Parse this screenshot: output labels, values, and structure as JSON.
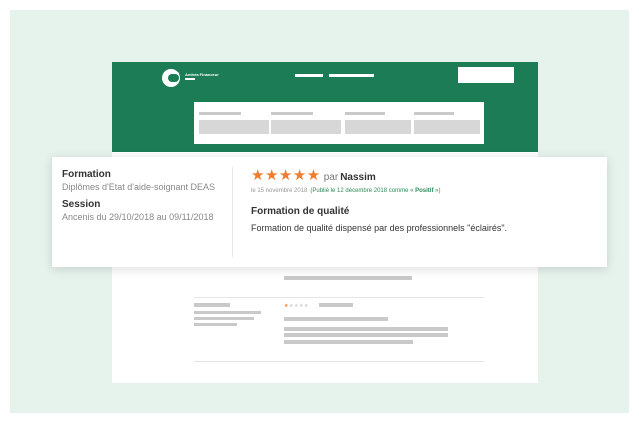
{
  "header": {
    "brand_name": "Anthéa Financeur"
  },
  "review": {
    "formation_label": "Formation",
    "formation_value": "Diplômes d'Etat d'aide-soignant DEAS",
    "session_label": "Session",
    "session_value": "Ancenis du 29/10/2018 au 09/11/2018",
    "rating": 5,
    "stars_text": "★★★★★",
    "by_label": "par",
    "author": "Nassim",
    "date_text": "le 15 novembre 2018",
    "published_text": "(Publié le 12 décembre 2018 comme «",
    "sentiment": "Positif",
    "published_close": "»)",
    "title": "Formation de qualité",
    "body": "Formation de qualité dispensé par des professionnels \"éclairés\"."
  },
  "second_review": {
    "rating": 1,
    "stars_on": "★",
    "stars_off": "★★★★"
  },
  "colors": {
    "brand_green": "#1c7c55",
    "background": "#e6f2ec",
    "star_orange": "#f07c2c",
    "link_green": "#2e8b57"
  }
}
